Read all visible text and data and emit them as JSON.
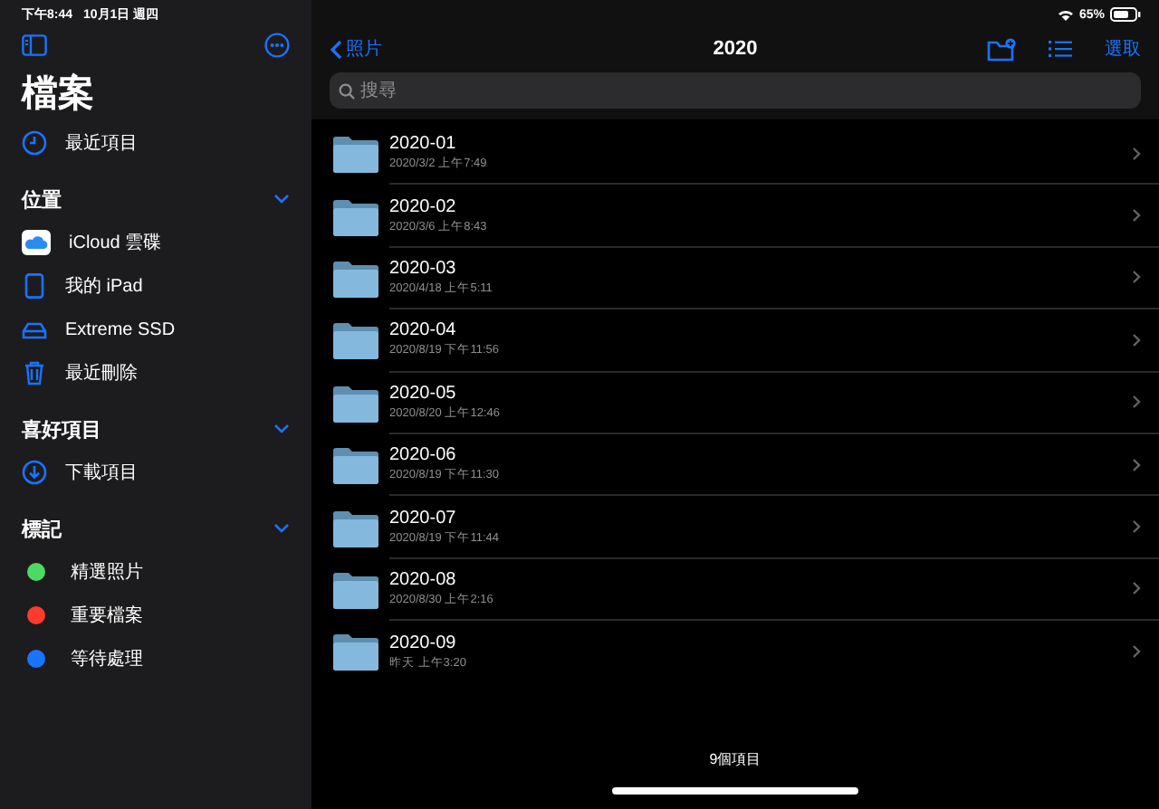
{
  "status_bar": {
    "time": "下午8:44",
    "date": "10月1日 週四",
    "battery": "65%"
  },
  "sidebar": {
    "title": "檔案",
    "top_items": [
      {
        "label": "最近項目",
        "kind": "clock"
      }
    ],
    "sections": [
      {
        "title": "位置",
        "expanded": true,
        "items": [
          {
            "label": "iCloud 雲碟",
            "kind": "icloud"
          },
          {
            "label": "我的 iPad",
            "kind": "ipad"
          },
          {
            "label": "Extreme SSD",
            "kind": "drive"
          },
          {
            "label": "最近刪除",
            "kind": "trash"
          }
        ]
      },
      {
        "title": "喜好項目",
        "expanded": true,
        "items": [
          {
            "label": "下載項目",
            "kind": "download"
          }
        ]
      },
      {
        "title": "標記",
        "expanded": true,
        "items": [
          {
            "label": "精選照片",
            "kind": "tag",
            "color": "#4cd964"
          },
          {
            "label": "重要檔案",
            "kind": "tag",
            "color": "#ff3b30"
          },
          {
            "label": "等待處理",
            "kind": "tag",
            "color": "#1a73ff"
          }
        ]
      }
    ]
  },
  "navigation": {
    "back": "照片",
    "title": "2020",
    "select": "選取"
  },
  "search": {
    "placeholder": "搜尋"
  },
  "folders": [
    {
      "name": "2020-01",
      "date": "2020/3/2 上午7:49"
    },
    {
      "name": "2020-02",
      "date": "2020/3/6 上午8:43"
    },
    {
      "name": "2020-03",
      "date": "2020/4/18 上午5:11"
    },
    {
      "name": "2020-04",
      "date": "2020/8/19 下午11:56"
    },
    {
      "name": "2020-05",
      "date": "2020/8/20 上午12:46"
    },
    {
      "name": "2020-06",
      "date": "2020/8/19 下午11:30"
    },
    {
      "name": "2020-07",
      "date": "2020/8/19 下午11:44"
    },
    {
      "name": "2020-08",
      "date": "2020/8/30 上午2:16"
    },
    {
      "name": "2020-09",
      "date": "昨天 上午3:20"
    }
  ],
  "footer": "9個項目"
}
